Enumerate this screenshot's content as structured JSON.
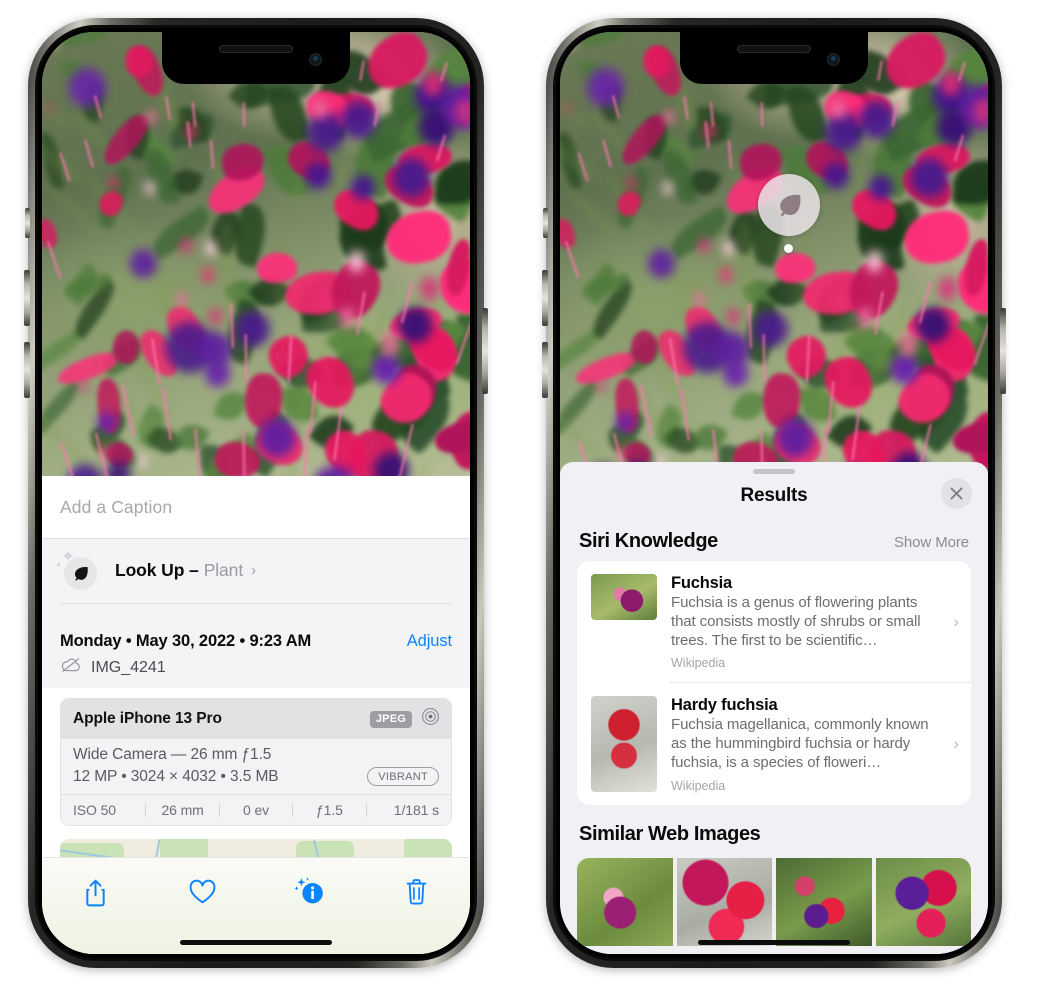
{
  "left_phone": {
    "caption_placeholder": "Add a Caption",
    "lookup": {
      "label": "Look Up –",
      "subject": "Plant",
      "chevron": "›",
      "icon": "leaf-icon",
      "sparkle": "✦"
    },
    "meta": {
      "date": "Monday • May 30, 2022 • 9:23 AM",
      "adjust_label": "Adjust",
      "filename": "IMG_4241",
      "cloud_icon": "cloud-slash-icon"
    },
    "camera": {
      "model": "Apple iPhone 13 Pro",
      "format_chip": "JPEG",
      "aperture_icon": "aperture-icon",
      "lens_line": "Wide Camera — 26 mm ƒ1.5",
      "size_line": "12 MP • 3024 × 4032 • 3.5 MB",
      "style_chip": "VIBRANT",
      "exif": [
        "ISO 50",
        "26 mm",
        "0 ev",
        "ƒ1.5",
        "1/181 s"
      ]
    },
    "toolbar": [
      {
        "name": "share-button",
        "icon": "share-icon"
      },
      {
        "name": "favorite-button",
        "icon": "heart-icon"
      },
      {
        "name": "info-button",
        "icon": "info-sparkle-icon"
      },
      {
        "name": "delete-button",
        "icon": "trash-icon"
      }
    ],
    "accent_color": "#0a84ff"
  },
  "right_phone": {
    "badge": {
      "icon": "leaf-icon",
      "name": "visual-lookup-badge"
    },
    "sheet": {
      "title": "Results",
      "close_icon": "close-icon",
      "sections": [
        {
          "title": "Siri Knowledge",
          "action": "Show More",
          "items": [
            {
              "title": "Fuchsia",
              "description": "Fuchsia is a genus of flowering plants that consists mostly of shrubs or small trees. The first to be scientific…",
              "source": "Wikipedia",
              "chevron": "›"
            },
            {
              "title": "Hardy fuchsia",
              "description": "Fuchsia magellanica, commonly known as the hummingbird fuchsia or hardy fuchsia, is a species of floweri…",
              "source": "Wikipedia",
              "chevron": "›"
            }
          ]
        },
        {
          "title": "Similar Web Images",
          "images": [
            "web-image-1",
            "web-image-2",
            "web-image-3",
            "web-image-4"
          ]
        }
      ]
    }
  }
}
